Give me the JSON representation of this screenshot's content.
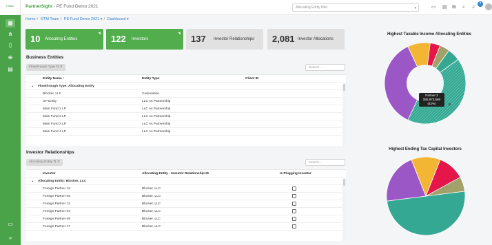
{
  "header": {
    "brand": "PartnerSight",
    "tenant": "PE Fund Demo 2021",
    "logo_text": "FSBA",
    "entity_filter_placeholder": "Allocating Entity filter",
    "notification_count": "7",
    "icons": [
      "document-icon",
      "stack-icon",
      "table-icon",
      "search-icon",
      "bell-icon",
      "notification-icon",
      "user-avatar"
    ]
  },
  "sidebar": {
    "items": [
      "grid-icon",
      "hierarchy-icon",
      "file-icon",
      "file-plus-icon",
      "file-list-icon",
      "monitor-icon",
      "expand-icon"
    ]
  },
  "breadcrumb": [
    "Home",
    "GTM Team",
    "PE Fund Demo 2021 ▾",
    "Dashboard ▾"
  ],
  "tiles": [
    {
      "number": "10",
      "label": "Allocating Entities",
      "style": "green"
    },
    {
      "number": "122",
      "label": "Investors",
      "style": "green"
    },
    {
      "number": "137",
      "label": "Investor Relationships",
      "style": "gray"
    },
    {
      "number": "2,081",
      "label": "Investor Allocations",
      "style": "gray"
    }
  ],
  "business_entities": {
    "title": "Business Entities",
    "group_chip": "Flowthrough Type ⇅ ✕",
    "search_placeholder": "Search...",
    "columns": [
      "Entity Name ↑",
      "Entity Type",
      "Client ID"
    ],
    "group_label": "Flowthrough Type: Allocating Entity",
    "rows": [
      {
        "name": "Blocker, LLC",
        "type": "Corporation"
      },
      {
        "name": "GP Entity",
        "type": "LLC As Partnership"
      },
      {
        "name": "Main Fund 1 LP",
        "type": "LLC As Partnership"
      },
      {
        "name": "Main Fund 2 LP",
        "type": "LLC As Partnership"
      },
      {
        "name": "Main Fund 3 LP",
        "type": "LLC As Partnership"
      },
      {
        "name": "Main Fund 4 LP",
        "type": "LLC As Partnership"
      }
    ]
  },
  "investor_relationships": {
    "title": "Investor Relationships",
    "group_chip": "Allocating Entity ⇅ ✕",
    "search_placeholder": "Search...",
    "columns": [
      "Investor",
      "Allocating Entity - Investor Relationship ID",
      "Is Plugging Investor"
    ],
    "group_label": "Allocating Entity: Blocker, LLC",
    "rows": [
      {
        "investor": "Foreign Partner 16",
        "entity": "Blocker, LLC"
      },
      {
        "investor": "Foreign Partner 05",
        "entity": "Blocker, LLC"
      },
      {
        "investor": "Foreign Partner 12",
        "entity": "Blocker, LLC"
      },
      {
        "investor": "Foreign Partner 02",
        "entity": "Blocker, LLC"
      },
      {
        "investor": "Foreign Partner 08",
        "entity": "Blocker, LLC"
      },
      {
        "investor": "Foreign Partner 17",
        "entity": "Blocker, LLC"
      }
    ]
  },
  "chart_data": [
    {
      "type": "pie",
      "title": "Highest Taxable Income Allocating Entities",
      "values": [
        42,
        36,
        9,
        4,
        4,
        5
      ],
      "colors": [
        "#34a892",
        "#9b57c6",
        "#f3b534",
        "#e4164a",
        "#a2a16a",
        "#34a892"
      ],
      "hatched_index": 0,
      "tooltip": {
        "line1": "Partner 3",
        "line2": "$45,973,569",
        "line3": "(42%)"
      }
    },
    {
      "type": "pie",
      "title": "Highest Ending Tax Capital Investors",
      "values": [
        50,
        21,
        12,
        11,
        6
      ],
      "colors": [
        "#34a892",
        "#9b57c6",
        "#f3b534",
        "#e4164a",
        "#a2a16a"
      ]
    }
  ]
}
